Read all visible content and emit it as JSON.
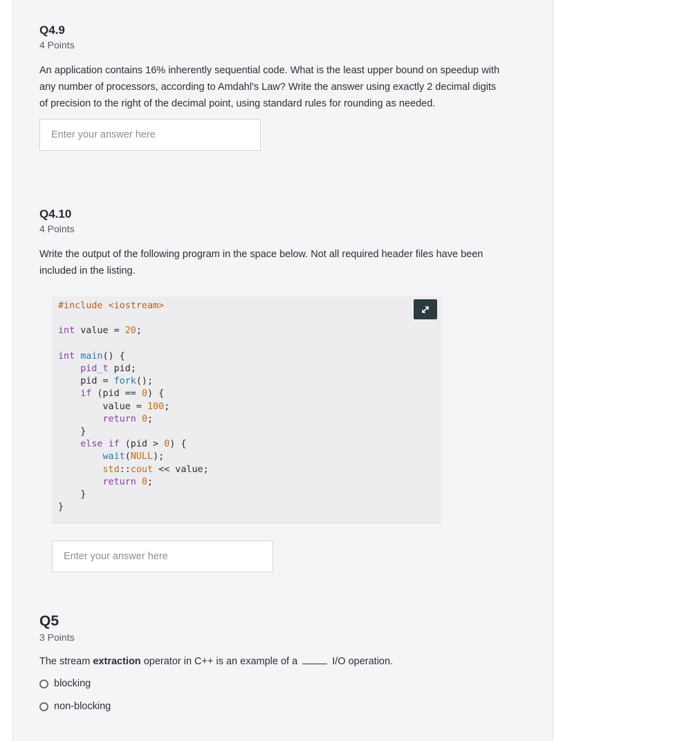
{
  "questions": {
    "q49": {
      "title": "Q4.9",
      "points": "4 Points",
      "text": "An application contains 16% inherently sequential code. What is the least upper bound on speedup with any number of processors, according to Amdahl's Law? Write the answer using exactly 2 decimal digits of precision to the right of the decimal point, using standard rules for rounding as needed.",
      "answer_placeholder": "Enter your answer here",
      "answer_value": ""
    },
    "q410": {
      "title": "Q4.10",
      "points": "4 Points",
      "text": "Write the output of the following program in the space below. Not all required header files have been included in the listing.",
      "code_lines": [
        "#include <iostream>",
        "",
        "int value = 20;",
        "",
        "int main() {",
        "    pid_t pid;",
        "    pid = fork();",
        "    if (pid == 0) {",
        "        value = 100;",
        "        return 0;",
        "    }",
        "    else if (pid > 0) {",
        "        wait(NULL);",
        "        std::cout << value;",
        "        return 0;",
        "    }",
        "}"
      ],
      "expand_icon": "expand-arrows-icon",
      "answer_placeholder": "Enter your answer here",
      "answer_value": ""
    },
    "q5": {
      "title": "Q5",
      "points": "3 Points",
      "text_before": "The stream ",
      "text_bold": "extraction",
      "text_middle": " operator in C++ is an example of a ",
      "text_after": " I/O operation.",
      "options": [
        "blocking",
        "non-blocking"
      ]
    }
  },
  "colors": {
    "panel_bg": "#f5f5f7",
    "code_bg": "#ededf0",
    "expand_button": "#2b3b3f"
  }
}
